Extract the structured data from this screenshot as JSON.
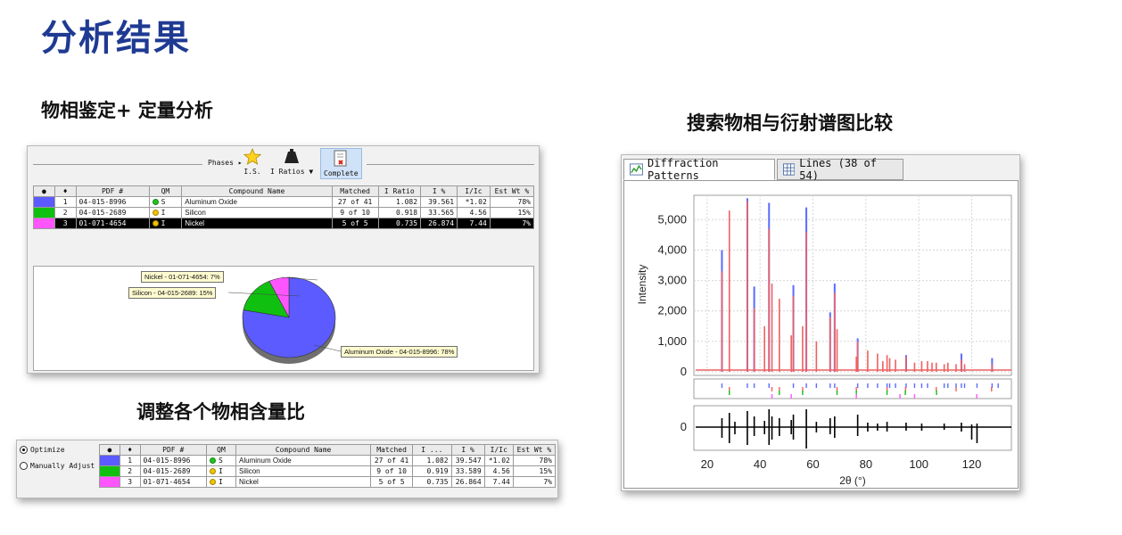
{
  "page_title": "分析结果",
  "section_phase_id": "物相鉴定+ 定量分析",
  "section_adjust": "调整各个物相含量比",
  "section_compare": "搜索物相与衍射谱图比较",
  "phase_panel": {
    "toolbar": {
      "phases_label": "Phases ▸",
      "is_label": "I.S.",
      "iratios_label": "I Ratios ▼",
      "complete_label": "Complete"
    },
    "columns": [
      "PDF #",
      "QM",
      "Compound Name",
      "Matched",
      "I Ratio",
      "I %",
      "I/Ic",
      "Est Wt %"
    ],
    "rows": [
      {
        "color": "#5b5bff",
        "no": "1",
        "pdf": "04-015-8996",
        "qm_color": "#22c322",
        "qm": "S",
        "name": "Aluminum Oxide",
        "matched": "27 of 41",
        "iratio": "1.082",
        "ipct": "39.561",
        "iic": "*1.02",
        "wt": "78%"
      },
      {
        "color": "#10c010",
        "no": "2",
        "pdf": "04-015-2689",
        "qm_color": "#f2c200",
        "qm": "I",
        "name": "Silicon",
        "matched": "9 of 10",
        "iratio": "0.918",
        "ipct": "33.565",
        "iic": "4.56",
        "wt": "15%"
      },
      {
        "color": "#ff55ff",
        "no": "3",
        "pdf": "01-071-4654",
        "qm_color": "#f2c200",
        "qm": "I",
        "name": "Nickel",
        "matched": "5 of 5",
        "iratio": "0.735",
        "ipct": "26.874",
        "iic": "7.44",
        "wt": "7%"
      }
    ],
    "pie": {
      "slices": [
        {
          "label": "Aluminum Oxide - 04-015-8996: 78%",
          "value": 78,
          "color": "#5b5bff"
        },
        {
          "label": "Silicon - 04-015-2689: 15%",
          "value": 15,
          "color": "#10c010"
        },
        {
          "label": "Nickel - 01-071-4654: 7%",
          "value": 7,
          "color": "#ff55ff"
        }
      ]
    }
  },
  "adjust_panel": {
    "optimize_label": "Optimize",
    "manual_label": "Manually Adjust",
    "columns": [
      "PDF #",
      "QM",
      "Compound Name",
      "Matched",
      "I ...",
      "I %",
      "I/Ic",
      "Est Wt %"
    ],
    "rows": [
      {
        "color": "#5b5bff",
        "no": "1",
        "pdf": "04-015-8996",
        "qm_color": "#22c322",
        "qm": "S",
        "name": "Aluminum Oxide",
        "matched": "27 of 41",
        "iratio": "1.082",
        "ipct": "39.547",
        "iic": "*1.02",
        "wt": "78%"
      },
      {
        "color": "#10c010",
        "no": "2",
        "pdf": "04-015-2689",
        "qm_color": "#f2c200",
        "qm": "I",
        "name": "Silicon",
        "matched": "9 of 10",
        "iratio": "0.919",
        "ipct": "33.589",
        "iic": "4.56",
        "wt": "15%"
      },
      {
        "color": "#ff55ff",
        "no": "3",
        "pdf": "01-071-4654",
        "qm_color": "#f2c200",
        "qm": "I",
        "name": "Nickel",
        "matched": "5 of 5",
        "iratio": "0.735",
        "ipct": "26.864",
        "iic": "7.44",
        "wt": "7%"
      }
    ]
  },
  "diffraction_panel": {
    "tab_patterns": "Diffraction Patterns",
    "tab_lines": "Lines (38 of 54)"
  },
  "chart_data": {
    "type": "line",
    "xlabel": "2θ (°)",
    "ylabel": "Intensity",
    "xlim": [
      15,
      135
    ],
    "ylim": [
      0,
      5800
    ],
    "x_ticks": [
      "20",
      "40",
      "60",
      "80",
      "100",
      "120"
    ],
    "y_ticks": [
      "0",
      "1,000",
      "2,000",
      "3,000",
      "4,000",
      "5,000"
    ],
    "residual_ticks": [
      "0"
    ],
    "grid": true,
    "series": [
      {
        "color": "#5b6bff",
        "peaks_x": [
          25.6,
          35.2,
          37.8,
          43.4,
          52.6,
          57.5,
          66.5,
          68.2,
          76.9,
          95.2,
          116.1,
          127.7
        ],
        "peaks_y": [
          4000,
          5700,
          2800,
          5550,
          2850,
          5400,
          1950,
          2900,
          1100,
          550,
          600,
          450
        ]
      },
      {
        "color": "#f06060",
        "peaks_x": [
          25.6,
          28.4,
          35.2,
          37.8,
          41.7,
          43.4,
          44.5,
          47.3,
          51.8,
          52.6,
          56.1,
          57.5,
          61.3,
          66.5,
          68.2,
          69.1,
          76.4,
          76.9,
          80.7,
          84.4,
          86.4,
          88.0,
          89.0,
          91.2,
          95.2,
          98.4,
          101.1,
          103.3,
          105.0,
          106.6,
          109.6,
          111.0,
          114.1,
          116.1,
          117.3,
          127.7
        ],
        "peaks_y": [
          3300,
          5300,
          5600,
          2100,
          1500,
          4700,
          2900,
          2400,
          1200,
          2500,
          1500,
          4600,
          1000,
          1800,
          2600,
          1400,
          500,
          1000,
          700,
          600,
          350,
          550,
          450,
          400,
          500,
          300,
          350,
          350,
          300,
          300,
          250,
          300,
          250,
          400,
          250,
          250
        ]
      }
    ]
  }
}
